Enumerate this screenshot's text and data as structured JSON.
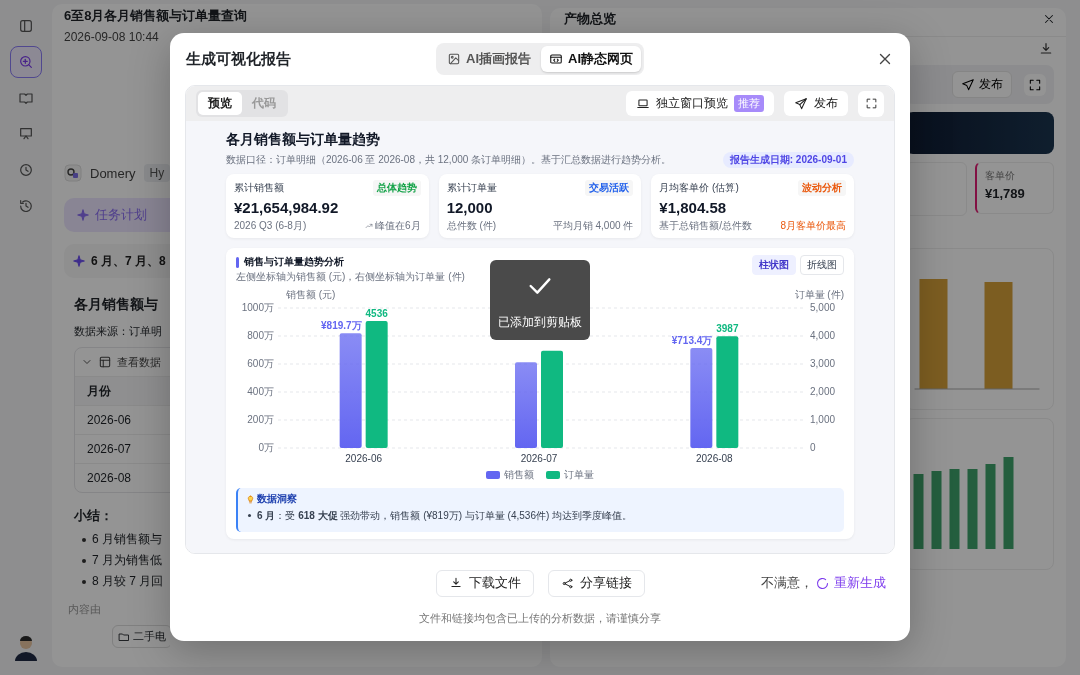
{
  "rail": {
    "items": [
      {
        "kind": "panel",
        "selected": false
      },
      {
        "kind": "new-chat",
        "selected": true
      },
      {
        "kind": "book",
        "selected": false
      },
      {
        "kind": "presentation",
        "selected": false
      },
      {
        "kind": "clock",
        "selected": false
      },
      {
        "kind": "history",
        "selected": false
      }
    ]
  },
  "conversation": {
    "title": "6至8月各月销售额与订单量查询",
    "time": "2026-09-08 10:44",
    "agent": {
      "name": "Domery",
      "badge": "Hy"
    },
    "task_button": "任务计划",
    "query": "6 月、7 月、8",
    "heading": "各月销售额与",
    "source": "数据来源：订单明",
    "table": {
      "toggle": "查看数据",
      "columns": [
        "月份"
      ],
      "rows": [
        [
          "2026-06"
        ],
        [
          "2026-07"
        ],
        [
          "2026-08"
        ]
      ]
    },
    "summary_title": "小结：",
    "summary": [
      "6 月销售额与",
      "7 月为销售低",
      "8 月较 7 月回"
    ],
    "footer_note": "内容由",
    "folder_chip": "二手电"
  },
  "artifacts": {
    "title": "产物总览",
    "publish": "发布",
    "kpi": {
      "label": "客单价",
      "value": "¥1,789"
    }
  },
  "dialog": {
    "title": "生成可视化报告",
    "tabs": [
      {
        "label": "AI插画报告",
        "kind": "image",
        "selected": false
      },
      {
        "label": "AI静态网页",
        "kind": "code",
        "selected": true
      }
    ],
    "preview_tabs": [
      {
        "label": "预览",
        "selected": true
      },
      {
        "label": "代码",
        "selected": false
      }
    ],
    "window_preview": {
      "label": "独立窗口预览",
      "badge": "推荐"
    },
    "publish": "发布",
    "report": {
      "title": "各月销售额与订单量趋势",
      "subtitle": "数据口径：订单明细（2026-06 至 2026-08，共 12,000 条订单明细）。基于汇总数据进行趋势分析。",
      "date_badge": "报告生成日期: 2026-09-01",
      "kpis": [
        {
          "label": "累计销售额",
          "tag": "总体趋势",
          "color": "#16a34a",
          "value": "¥21,654,984.92",
          "note": "2026 Q3 (6-8月)",
          "side_note": "峰值在6月",
          "kind": "trend"
        },
        {
          "label": "累计订单量",
          "tag": "交易活跃",
          "color": "#2563eb",
          "value": "12,000",
          "note": "总件数 (件)",
          "side_note": "平均月销 4,000 件",
          "kind": "plain"
        },
        {
          "label": "月均客单价 (估算)",
          "tag": "波动分析",
          "color": "#ea580c",
          "value": "¥1,804.58",
          "note": "基于总销售额/总件数",
          "side_note": "8月客单价最高",
          "kind": "highlight"
        }
      ],
      "chart": {
        "title": "销售与订单量趋势分析",
        "subtitle": "左侧坐标轴为销售额 (元)，右侧坐标轴为订单量 (件)",
        "toggles": [
          {
            "label": "柱状图",
            "selected": true
          },
          {
            "label": "折线图",
            "selected": false
          }
        ],
        "chart_data": {
          "type": "bar",
          "ylabel": "销售额 (元)",
          "y2label": "订单量 (件)",
          "categories": [
            "2026-06",
            "2026-07",
            "2026-08"
          ],
          "series": [
            {
              "name": "销售额",
              "color": "#6366f1",
              "values": [
                819.7,
                613,
                713.4
              ],
              "value_labels": [
                "¥819.7万",
                null,
                "¥713.4万"
              ]
            },
            {
              "name": "订单量",
              "color": "#10b981",
              "axis": "y2",
              "values": [
                4536,
                3477,
                3987
              ],
              "value_labels": [
                "4536",
                null,
                "3987"
              ]
            }
          ],
          "grid": true,
          "ylim": [
            0,
            1000
          ],
          "yticks": [
            {
              "value": 0,
              "label": "0万"
            },
            {
              "value": 200,
              "label": "200万"
            },
            {
              "value": 400,
              "label": "400万"
            },
            {
              "value": 600,
              "label": "600万"
            },
            {
              "value": 800,
              "label": "800万"
            },
            {
              "value": 1000,
              "label": "1000万"
            }
          ],
          "y2lim": [
            0,
            5000
          ],
          "y2ticks": [
            {
              "value": 0,
              "label": "0"
            },
            {
              "value": 1000,
              "label": "1,000"
            },
            {
              "value": 2000,
              "label": "2,000"
            },
            {
              "value": 3000,
              "label": "3,000"
            },
            {
              "value": 4000,
              "label": "4,000"
            },
            {
              "value": 5000,
              "label": "5,000"
            }
          ]
        }
      },
      "insight": {
        "title": "数据洞察",
        "items": [
          "**6 月**：受 **618 大促** 强劲带动，销售额 (¥819万) 与订单量 (4,536件) 均达到季度峰值。"
        ]
      }
    },
    "toast": "已添加到剪贴板",
    "actions": [
      {
        "label": "下载文件",
        "kind": "download"
      },
      {
        "label": "分享链接",
        "kind": "share"
      }
    ],
    "regenerate_prompt": "不满意，",
    "regenerate": "重新生成",
    "notice": "文件和链接均包含已上传的分析数据，请谨慎分享"
  }
}
